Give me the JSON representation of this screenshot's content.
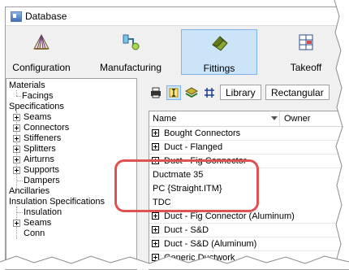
{
  "window": {
    "title": "Database"
  },
  "toolbar": {
    "tools": [
      {
        "label": "Configuration",
        "icon": "shell-configuration-icon"
      },
      {
        "label": "Manufacturing",
        "icon": "gear-pipe-manufacturing-icon"
      },
      {
        "label": "Fittings",
        "icon": "fittings-icon",
        "active": true
      },
      {
        "label": "Takeoff",
        "icon": "grid-takeoff-icon"
      }
    ]
  },
  "tree": {
    "items": [
      {
        "label": "Materials"
      },
      {
        "label": "Facings"
      },
      {
        "label": "Specifications"
      },
      {
        "label": "Seams"
      },
      {
        "label": "Connectors"
      },
      {
        "label": "Stiffeners"
      },
      {
        "label": "Splitters"
      },
      {
        "label": "Airturns"
      },
      {
        "label": "Supports"
      },
      {
        "label": "Dampers"
      },
      {
        "label": "Ancillaries"
      },
      {
        "label": "Insulation Specifications"
      },
      {
        "label": "Insulation"
      },
      {
        "label": "Seams"
      },
      {
        "label": "Conn"
      }
    ]
  },
  "fittings_toolbar": {
    "tabs": [
      {
        "label": "Library"
      },
      {
        "label": "Rectangular"
      }
    ]
  },
  "grid": {
    "columns": {
      "name": "Name",
      "owner": "Owner"
    },
    "rows": [
      {
        "text": "Bought Connectors"
      },
      {
        "text": "Duct - Flanged"
      },
      {
        "text": "Duct - Fig Connector"
      },
      {
        "text": "Ductmate 35"
      },
      {
        "text": "PC {Straight.ITM}"
      },
      {
        "text": "TDC"
      },
      {
        "text": "Duct - Fig Connector (Aluminum)"
      },
      {
        "text": "Duct - S&D"
      },
      {
        "text": "Duct - S&D (Aluminum)"
      },
      {
        "text": "Generic Ductwork"
      }
    ]
  },
  "colors": {
    "highlight": "#e05252",
    "selected_tool": "#cce4f7"
  }
}
